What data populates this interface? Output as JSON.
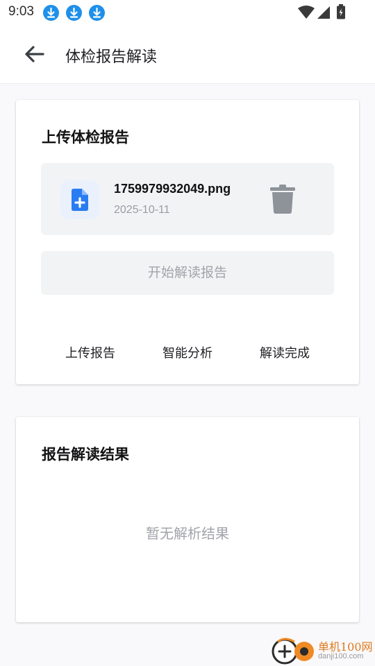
{
  "status_bar": {
    "time": "9:03",
    "notification_icons": [
      "download-icon",
      "download-icon",
      "download-icon"
    ],
    "right_icons": [
      "wifi-icon",
      "signal-icon",
      "battery-icon"
    ]
  },
  "header": {
    "back_icon": "arrow-left-icon",
    "title": "体检报告解读"
  },
  "upload_card": {
    "title": "上传体检报告",
    "file": {
      "icon": "file-add-icon",
      "name": "1759979932049.png",
      "date": "2025-10-11",
      "delete_icon": "trash-icon"
    },
    "start_button_label": "开始解读报告",
    "steps": [
      "上传报告",
      "智能分析",
      "解读完成"
    ]
  },
  "result_card": {
    "title": "报告解读结果",
    "empty_text": "暂无解析结果"
  },
  "watermark": {
    "name": "单机100网",
    "url": "danji100.com"
  },
  "colors": {
    "accent": "#2a7cf2",
    "icon_background": "#eaf1fd",
    "disabled_text": "#a2a4aa",
    "download_badge": "#1e90ea",
    "watermark": "#e07a1f"
  }
}
